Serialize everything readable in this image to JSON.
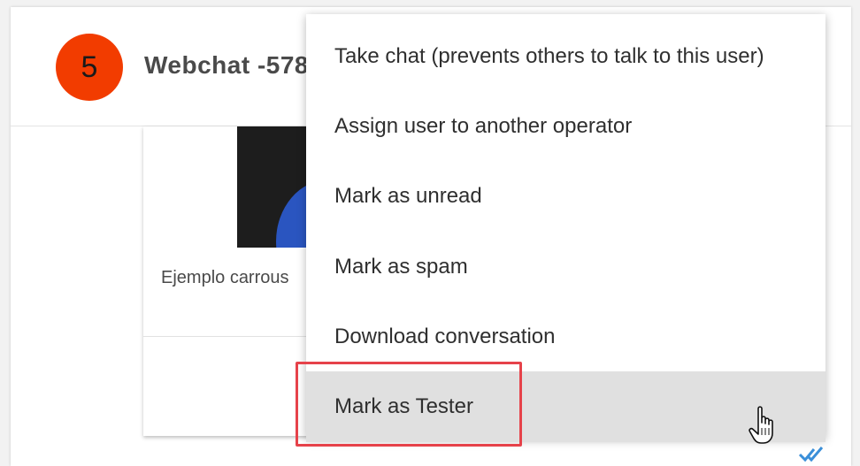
{
  "header": {
    "badge_count": "5",
    "title": "Webchat -578"
  },
  "message_card": {
    "caption": "Ejemplo carrous",
    "image_colors": {
      "background": "#1d1d1d",
      "shape": "#2a55c0"
    }
  },
  "context_menu": {
    "items": [
      {
        "label": "Take chat (prevents others to talk to this user)"
      },
      {
        "label": "Assign user to another operator"
      },
      {
        "label": "Mark as unread"
      },
      {
        "label": "Mark as spam"
      },
      {
        "label": "Download conversation"
      },
      {
        "label": "Mark as Tester",
        "hovered": true
      }
    ]
  },
  "icons": {
    "badge": "unread-count-badge",
    "read_receipt": "double-check-icon",
    "cursor": "hand-pointer-icon"
  },
  "colors": {
    "badge": "#f23c00",
    "menu_hover": "#e0e0e0",
    "annotation_box": "#e6424a",
    "read_receipt": "#3a8fd9"
  }
}
